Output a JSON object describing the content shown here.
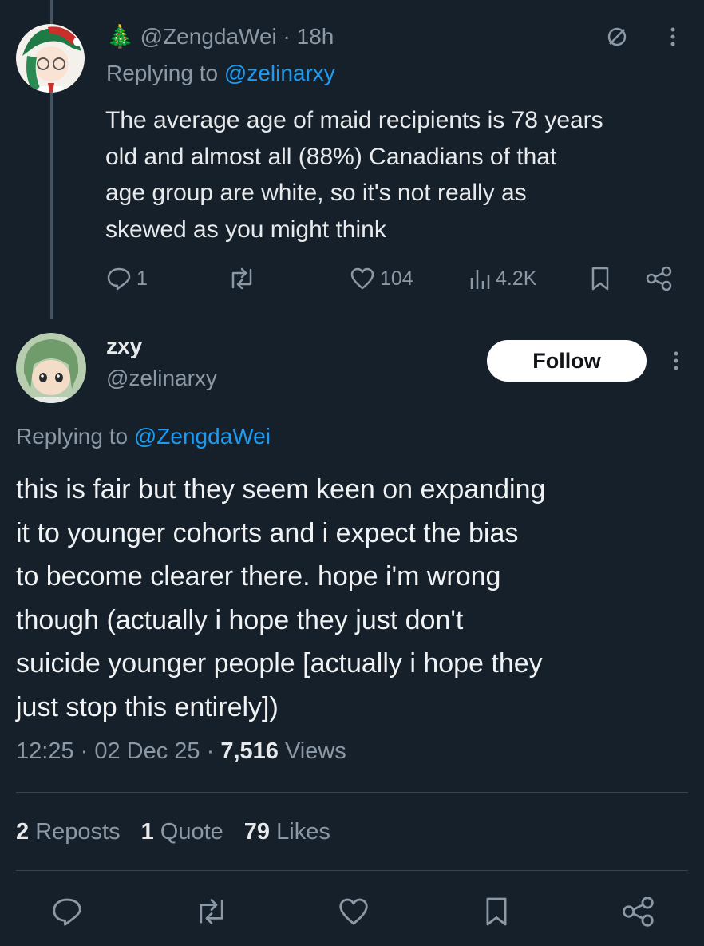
{
  "reply_tweet": {
    "emoji": "🎄",
    "handle": "@ZengdaWei",
    "separator": "·",
    "time": "18h",
    "replying_prefix": "Replying to",
    "replying_handle": "@zelinarxy",
    "text_lines": [
      "The average age of maid recipients is 78 years",
      "old and almost all (88%) Canadians of that",
      "age group  are white, so it's not really as",
      "skewed as you might think"
    ],
    "replies": "1",
    "likes": "104",
    "views": "4.2K",
    "icons": [
      "block-icon",
      "more-icon",
      "reply-icon",
      "repost-icon",
      "like-icon",
      "views-icon",
      "bookmark-icon",
      "share-icon"
    ]
  },
  "main_tweet": {
    "name": "zxy",
    "handle": "@zelinarxy",
    "follow_label": "Follow",
    "replying_prefix": "Replying to",
    "replying_handle": "@ZengdaWei",
    "text_lines": [
      "this is fair but they seem keen on expanding",
      "it to younger cohorts and i expect the bias",
      "to become clearer there. hope i'm wrong",
      "though (actually i hope they just don't",
      "suicide younger people [actually i hope they",
      "just stop this entirely])"
    ],
    "timestamp": "12:25 · 02 Dec 25 ·",
    "views_count": "7,516",
    "views_label": "Views",
    "reposts_count": "2",
    "reposts_label": "Reposts",
    "quotes_count": "1",
    "quotes_label": "Quote",
    "likes_count": "79",
    "likes_label": "Likes"
  },
  "colors": {
    "background": "#15202b",
    "text": "#e7e9ea",
    "muted": "#8b98a5",
    "link": "#1d9bf0"
  }
}
